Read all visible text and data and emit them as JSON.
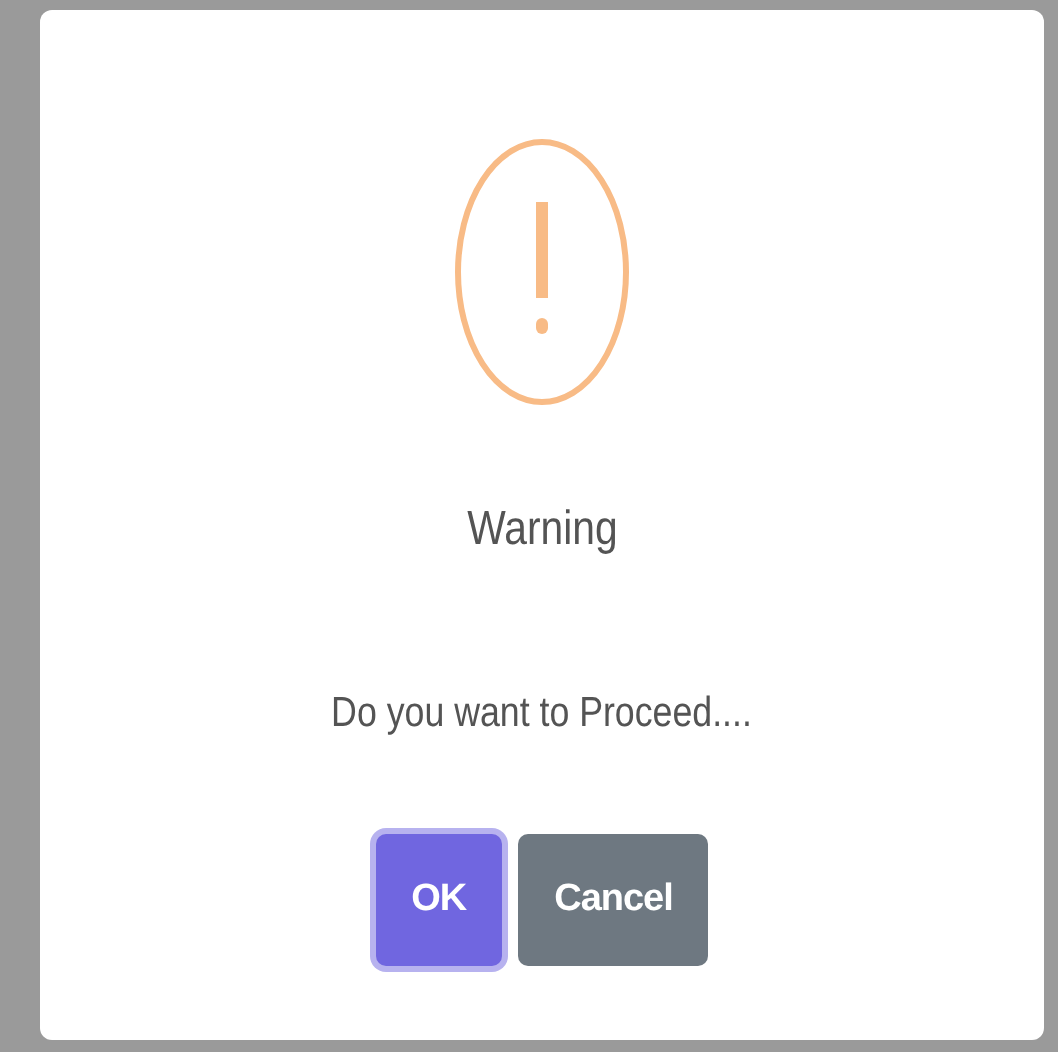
{
  "dialog": {
    "title": "Warning",
    "message": "Do you want to Proceed....",
    "buttons": [
      {
        "label": "OK",
        "kind": "confirm",
        "focused": true
      },
      {
        "label": "Cancel",
        "kind": "cancel",
        "focused": false
      }
    ]
  }
}
